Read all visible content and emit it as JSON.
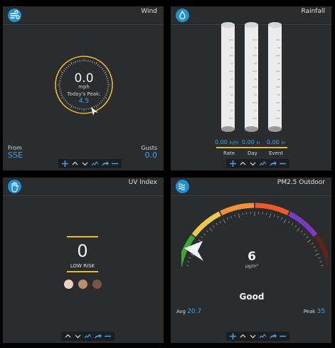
{
  "wind": {
    "title": "Wind",
    "speed": "0.0",
    "unit": "mph",
    "peak_label": "Today's Peak:",
    "peak_value": "4.5",
    "from_label": "From",
    "from_value": "SSE",
    "gusts_label": "Gusts",
    "gusts_value": "0.0",
    "icon": "wind-icon"
  },
  "rainfall": {
    "title": "Rainfall",
    "icon": "water-drop-icon",
    "gauges": [
      {
        "value": "0.00",
        "unit": "in/hr",
        "label": "Rate"
      },
      {
        "value": "0.00",
        "unit": "in",
        "label": "Day"
      },
      {
        "value": "0.00",
        "unit": "in",
        "label": "Event"
      }
    ]
  },
  "uv": {
    "title": "UV Index",
    "icon": "hand-icon",
    "value": "0",
    "risk": "LOW RISK",
    "skin_tones": [
      "#ead3bd",
      "#b98f6d",
      "#7b5644"
    ]
  },
  "pm25": {
    "title": "PM2.5 Outdoor",
    "icon": "waves-icon",
    "value": "6",
    "unit": "µg/m³",
    "quality": "Good",
    "avg_label": "Avg",
    "avg_value": "20.7",
    "peak_label": "Peak",
    "peak_value": "35"
  },
  "colors": {
    "accent": "#3ea4ee",
    "tile_bg": "#2b2c2e",
    "ring": "#e8b82e",
    "aqi_good": "#3aaa35",
    "aqi_moderate": "#f0c94a",
    "aqi_usg": "#f2913a",
    "aqi_unhealthy": "#ec5a2a",
    "aqi_very_unhealthy": "#7a3bc4",
    "aqi_hazardous": "#5b2417"
  }
}
